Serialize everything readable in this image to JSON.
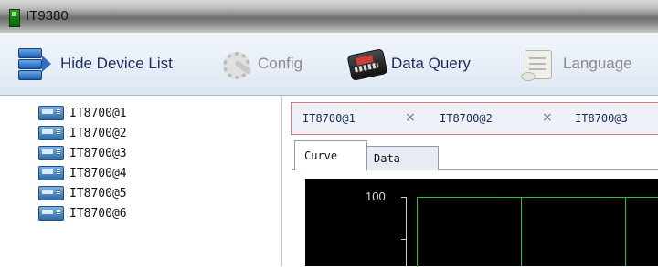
{
  "window": {
    "title": "IT9380"
  },
  "toolbar": {
    "items": [
      {
        "label": "Hide Device List",
        "icon": "device-list-icon",
        "enabled": true
      },
      {
        "label": "Config",
        "icon": "config-icon",
        "enabled": false
      },
      {
        "label": "Data Query",
        "icon": "data-query-icon",
        "enabled": true
      },
      {
        "label": "Language",
        "icon": "language-scroll-icon",
        "enabled": false
      }
    ]
  },
  "device_tree": {
    "items": [
      {
        "label": "IT8700@1",
        "icon": "device-icon"
      },
      {
        "label": "IT8700@2",
        "icon": "device-icon"
      },
      {
        "label": "IT8700@3",
        "icon": "device-icon"
      },
      {
        "label": "IT8700@4",
        "icon": "device-icon"
      },
      {
        "label": "IT8700@5",
        "icon": "device-icon"
      },
      {
        "label": "IT8700@6",
        "icon": "device-icon"
      }
    ]
  },
  "device_tabs": [
    {
      "label": "IT8700@1",
      "close": "×"
    },
    {
      "label": "IT8700@2",
      "close": "×"
    },
    {
      "label": "IT8700@3"
    }
  ],
  "view_tabs": [
    {
      "label": "Curve",
      "active": true
    },
    {
      "label": "Data",
      "active": false
    }
  ],
  "chart": {
    "y_top_tick": "100",
    "grid_color": "#2cc62c",
    "background": "#000000"
  },
  "colors": {
    "tab_highlight_border": "#e07a7a",
    "accent_text": "#1d2d5a"
  }
}
